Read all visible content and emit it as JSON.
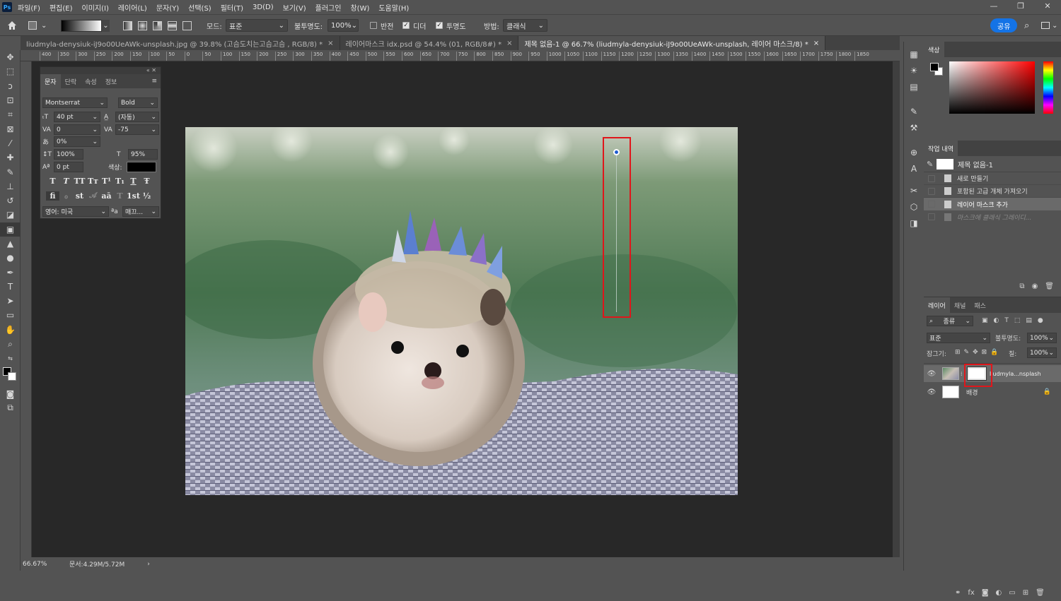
{
  "app": {
    "logo": "Ps"
  },
  "menu": [
    "파일(F)",
    "편집(E)",
    "이미지(I)",
    "레이어(L)",
    "문자(Y)",
    "선택(S)",
    "필터(T)",
    "3D(D)",
    "보기(V)",
    "플러그인",
    "창(W)",
    "도움말(H)"
  ],
  "window_controls": {
    "minimize": "—",
    "restore": "❐",
    "close": "✕"
  },
  "options": {
    "mode_label": "모드:",
    "mode_value": "표준",
    "opacity_label": "불투명도:",
    "opacity_value": "100%",
    "reverse_label": "반전",
    "dither_label": "디더",
    "transparency_label": "투명도",
    "method_label": "방법:",
    "method_value": "클래식",
    "share_label": "공유"
  },
  "tabs": [
    {
      "label": "liudmyla-denysiuk-iJ9o00UeAWk-unsplash.jpg @ 39.8% (고슴도치는고슴고슴 , RGB/8) *",
      "close": "×"
    },
    {
      "label": "레이어마스크 idx.psd @ 54.4% (01, RGB/8#) *",
      "close": "×"
    },
    {
      "label": "제목 없음-1 @ 66.7% (liudmyla-denysiuk-iJ9o00UeAWk-unsplash, 레이어 마스크/8) *",
      "close": "×"
    }
  ],
  "ruler_ticks": [
    "400",
    "350",
    "300",
    "250",
    "200",
    "150",
    "100",
    "50",
    "0",
    "50",
    "100",
    "150",
    "200",
    "250",
    "300",
    "350",
    "400",
    "450",
    "500",
    "550",
    "600",
    "650",
    "700",
    "750",
    "800",
    "850",
    "900",
    "950",
    "1000",
    "1050",
    "1100",
    "1150",
    "1200",
    "1250",
    "1300",
    "1350",
    "1400",
    "1450",
    "1500",
    "1550",
    "1600",
    "1650",
    "1700",
    "1750",
    "1800",
    "1850"
  ],
  "status": {
    "zoom": "66.67%",
    "doc": "문서:4.29M/5.72M",
    "arrow": "›"
  },
  "character_panel": {
    "collapse": "«  ✕",
    "tabs": [
      "문자",
      "단락",
      "속성",
      "정보"
    ],
    "font_family": "Montserrat",
    "font_style": "Bold",
    "size": "40 pt",
    "leading": "(자동)",
    "kerning": "0",
    "tracking": "-75",
    "tsume": "0%",
    "vscale": "100%",
    "hscale": "95%",
    "baseline": "0 pt",
    "color_label": "색상:",
    "glyph_row1": [
      "T",
      "T",
      "TT",
      "Tт",
      "T¹",
      "T₁",
      "T",
      "Ŧ"
    ],
    "glyph_row2": [
      "fi",
      "ℴ",
      "st",
      "𝒜",
      "aā",
      "T",
      "1st",
      "½"
    ],
    "language": "영어: 미국",
    "aa_label": "ªa",
    "aa_value": "매끄..."
  },
  "color_panel": {
    "title": "색상"
  },
  "history_panel": {
    "title": "작업 내역",
    "snapshot": "제목 없음-1",
    "items": [
      "새로 만들기",
      "포함된 고급 개체 가져오기",
      "레이어 마스크 추가",
      "마스크에 클래식 그레이디..."
    ]
  },
  "layers_panel": {
    "tabs": [
      "레이어",
      "채널",
      "패스"
    ],
    "filter_label": "종류",
    "blend": "표준",
    "opacity_label": "불투명도:",
    "opacity_value": "100%",
    "lock_label": "잠그기:",
    "fill_label": "칠:",
    "fill_value": "100%",
    "layers": [
      {
        "name": "liudmyla...nsplash"
      },
      {
        "name": "배경"
      }
    ]
  },
  "colors": {
    "accent": "#1473e6",
    "highlight": "#e0161b",
    "panel": "#535353",
    "canvas": "#282828"
  }
}
